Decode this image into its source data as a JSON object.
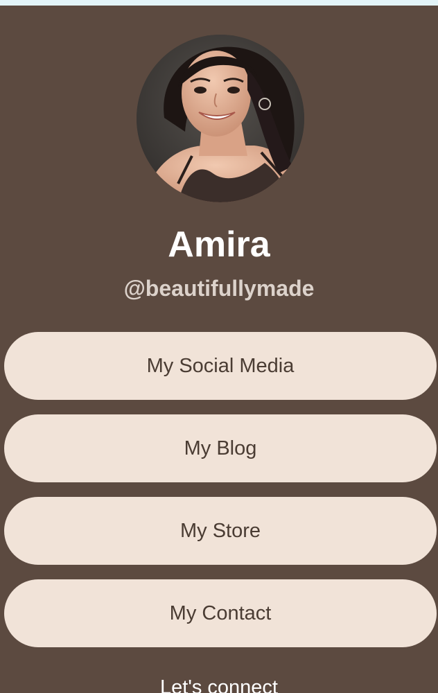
{
  "profile": {
    "name": "Amira",
    "handle": "@beautifullymade"
  },
  "links": [
    {
      "label": "My Social Media"
    },
    {
      "label": "My Blog"
    },
    {
      "label": "My Store"
    },
    {
      "label": "My Contact"
    }
  ],
  "footer": {
    "connect_text": "Let's connect"
  },
  "colors": {
    "page_top_strip": "#e3f4f8",
    "card_background": "#5c4a40",
    "button_background": "#f1e3d8",
    "button_text": "#4a3c33",
    "name_text": "#ffffff",
    "handle_text": "#dcd2cb"
  }
}
